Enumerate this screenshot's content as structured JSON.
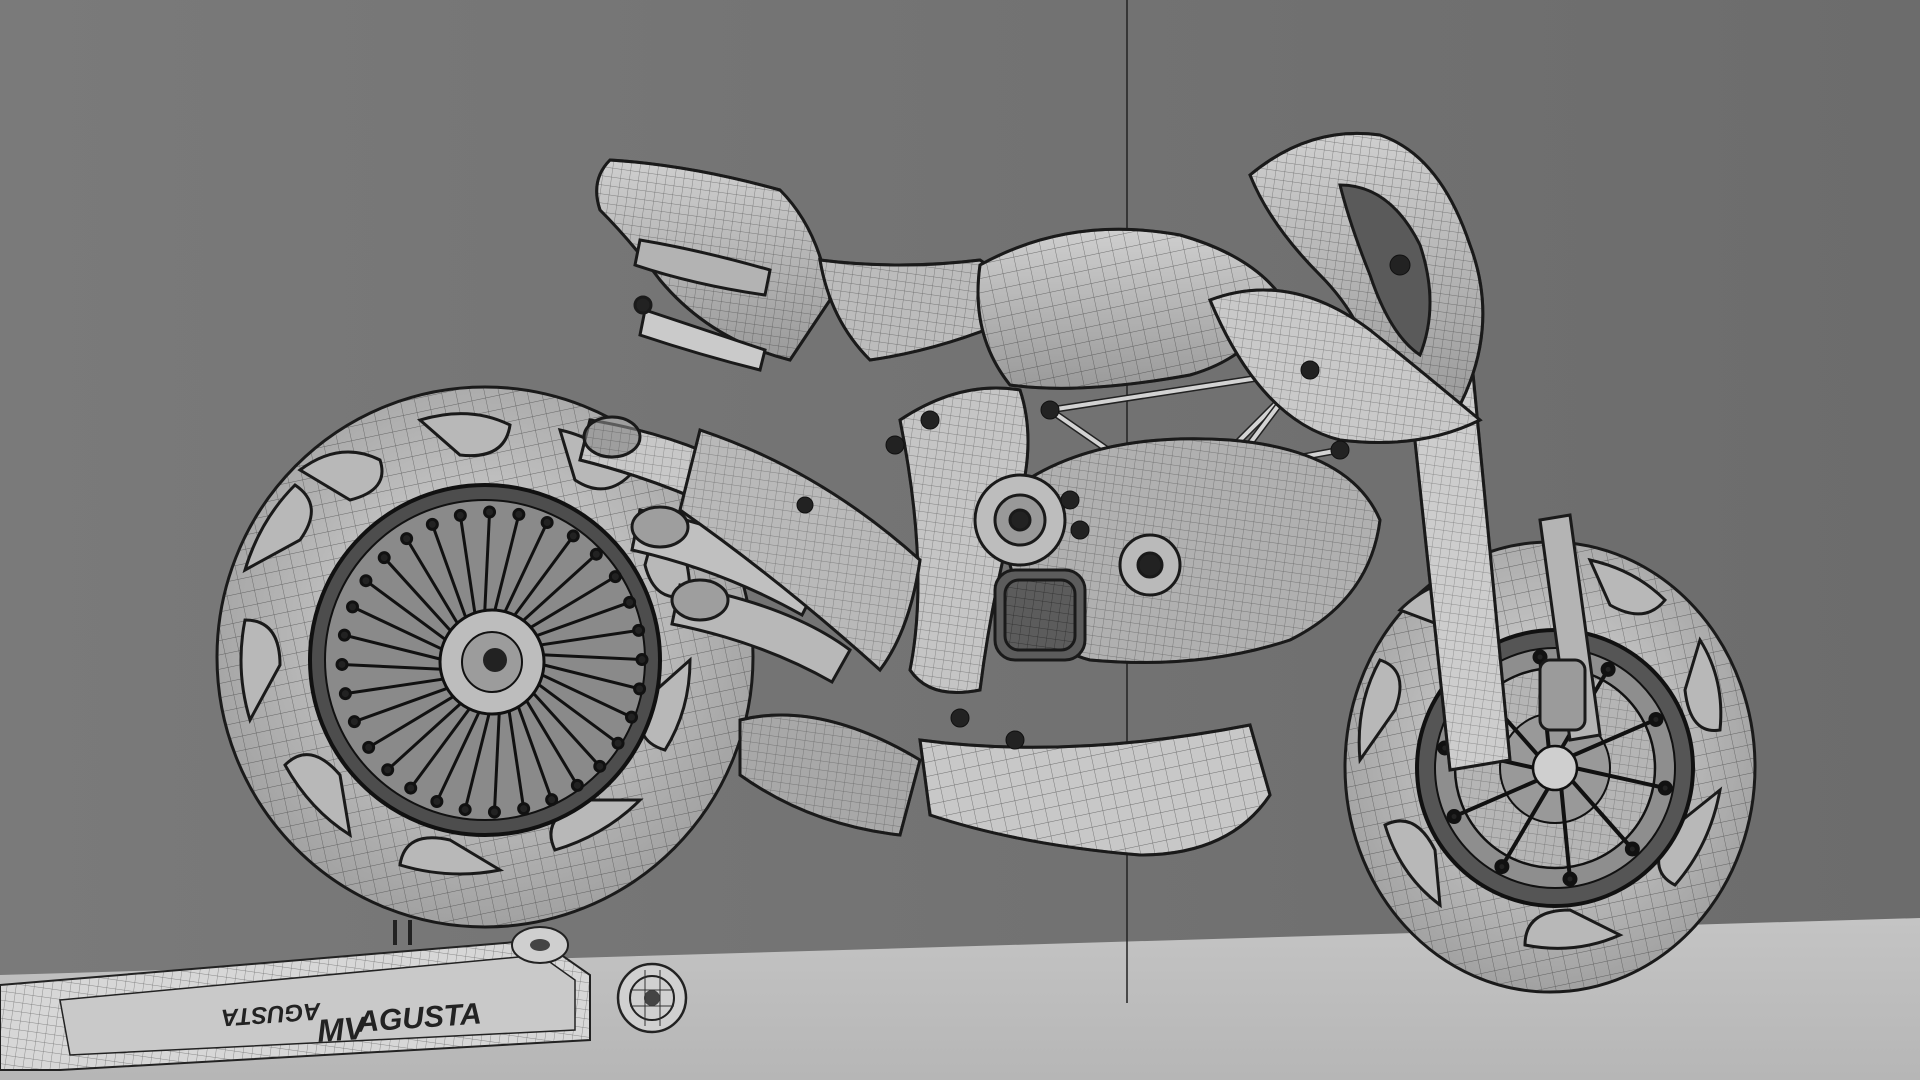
{
  "scene": {
    "background_color": "#767676",
    "floor_color": "#bdbdbd",
    "line_color": "#1a1a1a",
    "render_style": "wireframe-on-shaded"
  },
  "stand": {
    "brand_primary": "AGUSTA",
    "brand_mark": "MV",
    "brand_mirrored": "AGUSTA"
  },
  "icons": {
    "rear_wheel": "spoked-wheel",
    "front_wheel": "disc-wheel"
  }
}
